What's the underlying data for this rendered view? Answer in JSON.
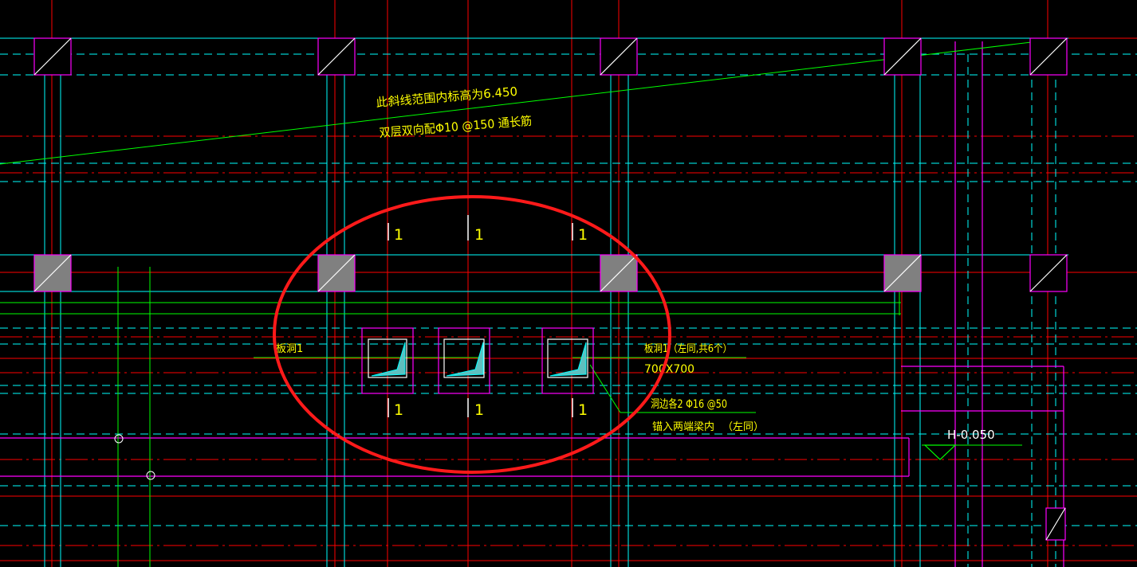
{
  "colors": {
    "background": "#000000",
    "axis_red": "#ff0000",
    "beam_cyan": "#00ffff",
    "beam_magenta": "#ff00ff",
    "leader_green": "#00ff00",
    "text_yellow": "#ffff00",
    "text_white": "#ffffff",
    "column_fill": "#808080",
    "highlight_circle": "#ff1a1a"
  },
  "notes": {
    "slope_line_1": "此斜线范围内标高为6.450",
    "slope_line_2": "双层双向配Φ10 @150 通长筋"
  },
  "section_marks": {
    "top": [
      "1",
      "1",
      "1"
    ],
    "bottom": [
      "1",
      "1",
      "1"
    ]
  },
  "callouts": {
    "opening_left": "板洞1",
    "opening_right_1": "板洞1（左同,共6个）",
    "opening_right_2": "700X700",
    "reinf_1": "洞边各2 Φ16 @50",
    "reinf_2": "锚入两端梁内",
    "reinf_3": "（左同）"
  },
  "elevation": {
    "label": "H-0.050"
  }
}
